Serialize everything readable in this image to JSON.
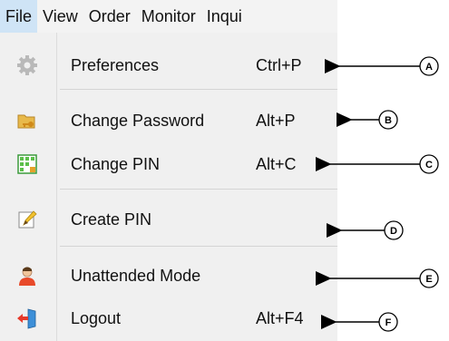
{
  "menubar": {
    "items": [
      {
        "label": "File"
      },
      {
        "label": "View"
      },
      {
        "label": "Order"
      },
      {
        "label": "Monitor"
      },
      {
        "label": "Inqui"
      }
    ]
  },
  "file_menu": {
    "items": [
      {
        "label": "Preferences",
        "shortcut": "Ctrl+P",
        "icon": "gear-icon"
      },
      {
        "label": "Change Password",
        "shortcut": "Alt+P",
        "icon": "folder-key-icon"
      },
      {
        "label": "Change PIN",
        "shortcut": "Alt+C",
        "icon": "grid-key-icon"
      },
      {
        "label": "Create PIN",
        "shortcut": "",
        "icon": "pencil-note-icon"
      },
      {
        "label": "Unattended Mode",
        "shortcut": "",
        "icon": "user-icon"
      },
      {
        "label": "Logout",
        "shortcut": "Alt+F4",
        "icon": "logout-door-icon"
      }
    ]
  },
  "callouts": [
    "A",
    "B",
    "C",
    "D",
    "E",
    "F"
  ],
  "colors": {
    "menu_bg": "#f0f0f0",
    "active_menu_bg": "#cfe4f6"
  }
}
